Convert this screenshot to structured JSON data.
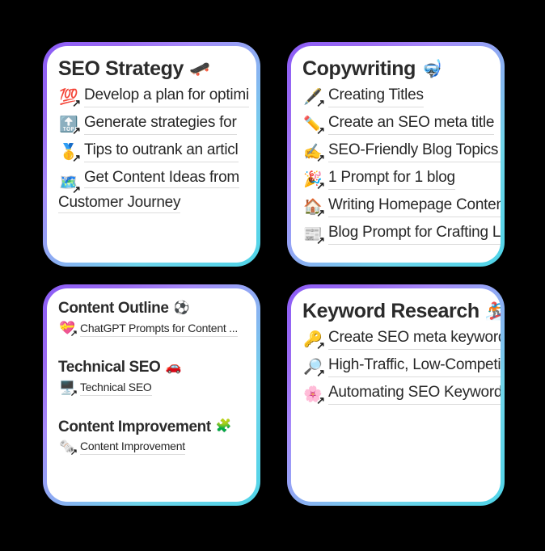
{
  "page": {
    "background_color": "#000000",
    "card_border_gradient_from": "#8B5CF6",
    "card_border_gradient_to": "#4FD4E8",
    "card_background_color": "#FFFFFF",
    "link_arrow_glyph": "↗"
  },
  "cards": [
    {
      "id": "seo-strategy",
      "title": "SEO Strategy",
      "title_emoji": "🛹",
      "title_emoji_name": "skateboard-emoji",
      "items": [
        {
          "emoji": "💯",
          "emoji_name": "hundred-points-emoji",
          "label": "Develop a plan for optimi"
        },
        {
          "emoji": "🔝",
          "emoji_name": "top-arrow-emoji",
          "label": "Generate strategies for "
        },
        {
          "emoji": "🥇",
          "emoji_name": "first-place-medal-emoji",
          "label": "Tips to outrank an articl"
        },
        {
          "emoji": "🗺️",
          "emoji_name": "world-map-emoji",
          "label": "Get Content Ideas from Customer Journey"
        }
      ]
    },
    {
      "id": "copywriting",
      "title": "Copywriting",
      "title_emoji": "🤿",
      "title_emoji_name": "diving-mask-emoji",
      "items": [
        {
          "emoji": "🖋️",
          "emoji_name": "fountain-pen-emoji",
          "label": "Creating Titles"
        },
        {
          "emoji": "✏️",
          "emoji_name": "pencil-emoji",
          "label": "Create an SEO meta title"
        },
        {
          "emoji": "✍️",
          "emoji_name": "writing-hand-emoji",
          "label": "SEO-Friendly Blog Topics Rel"
        },
        {
          "emoji": "🎉",
          "emoji_name": "party-popper-emoji",
          "label": "1 Prompt for 1 blog"
        },
        {
          "emoji": "🏠",
          "emoji_name": "house-emoji",
          "label": "Writing Homepage Content"
        },
        {
          "emoji": "📰",
          "emoji_name": "newspaper-emoji",
          "label": "Blog Prompt for Crafting Long"
        }
      ]
    },
    {
      "id": "content-outline",
      "groups": [
        {
          "title": "Content Outline",
          "title_emoji": "⚽",
          "title_emoji_name": "soccer-ball-emoji",
          "items": [
            {
              "emoji": "💝",
              "emoji_name": "heart-with-ribbon-emoji",
              "label": "ChatGPT Prompts for Content ..."
            }
          ]
        },
        {
          "title": "Technical SEO",
          "title_emoji": "🚗",
          "title_emoji_name": "car-emoji",
          "items": [
            {
              "emoji": "🖥️",
              "emoji_name": "desktop-computer-emoji",
              "label": "Technical SEO"
            }
          ]
        },
        {
          "title": "Content Improvement",
          "title_emoji": "🧩",
          "title_emoji_name": "puzzle-piece-emoji",
          "items": [
            {
              "emoji": "🗞️",
              "emoji_name": "rolled-newspaper-emoji",
              "label": "Content Improvement"
            }
          ]
        }
      ]
    },
    {
      "id": "keyword-research",
      "title": "Keyword Research",
      "title_emoji": "🏂",
      "title_emoji_name": "snowboarder-emoji",
      "items": [
        {
          "emoji": "🔑",
          "emoji_name": "key-emoji",
          "label": "Create SEO meta keywords"
        },
        {
          "emoji": "🔎",
          "emoji_name": "magnifying-glass-emoji",
          "label": "High-Traffic, Low-Competiti"
        },
        {
          "emoji": "🌸",
          "emoji_name": "cherry-blossom-emoji",
          "label": "Automating SEO Keyword Re"
        }
      ]
    }
  ]
}
